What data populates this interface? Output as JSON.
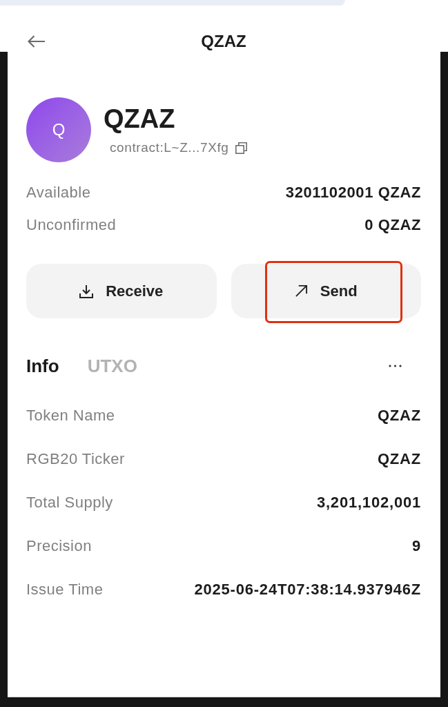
{
  "header": {
    "title": "QZAZ"
  },
  "asset": {
    "avatar_letter": "Q",
    "name": "QZAZ",
    "contract": "contract:L~Z...7Xfg"
  },
  "balances": [
    {
      "label": "Available",
      "value": "3201102001 QZAZ"
    },
    {
      "label": "Unconfirmed",
      "value": "0 QZAZ"
    }
  ],
  "actions": [
    {
      "kind": "receive",
      "label": "Receive",
      "highlighted": false
    },
    {
      "kind": "send",
      "label": "Send",
      "highlighted": true
    }
  ],
  "tabs": [
    {
      "label": "Info",
      "selected": true
    },
    {
      "label": "UTXO",
      "selected": false
    }
  ],
  "info": [
    {
      "label": "Token Name",
      "value": "QZAZ"
    },
    {
      "label": "RGB20 Ticker",
      "value": "QZAZ"
    },
    {
      "label": "Total Supply",
      "value": "3,201,102,001"
    },
    {
      "label": "Precision",
      "value": "9"
    },
    {
      "label": "Issue Time",
      "value": "2025-06-24T07:38:14.937946Z"
    }
  ]
}
